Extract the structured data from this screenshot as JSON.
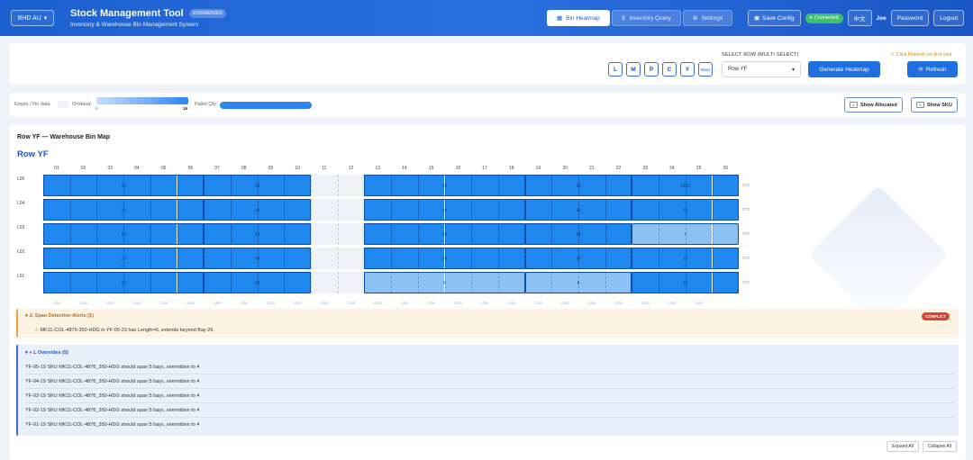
{
  "header": {
    "region": "BHD AU",
    "title": "Stock Management Tool",
    "version": "20260820002",
    "subtitle": "Inventory & Warehouse Bin Management System",
    "nav": [
      {
        "label": "Bin Heatmap",
        "icon": "grid-icon",
        "active": true
      },
      {
        "label": "Inventory Query",
        "icon": "search-icon",
        "active": false
      },
      {
        "label": "Settings",
        "icon": "gear-icon",
        "active": false
      }
    ],
    "save_config": "Save Config",
    "status": "Connected",
    "language": "中文",
    "user": "Joe",
    "password": "Password",
    "logout": "Logout"
  },
  "toolbar": {
    "row_buttons": [
      "L",
      "M",
      "P",
      "C",
      "Y",
      "More"
    ],
    "select_label": "SELECT ROW (MULTI SELECT)",
    "select_value": "Row YF",
    "generate": "Generate Heatmap",
    "refresh_hint": "Click Refresh on first visit",
    "refresh": "Refresh"
  },
  "legend": {
    "empty": "Empty / No data",
    "onhand": "OnHand:",
    "onhand_min": "0",
    "onhand_max": "16",
    "pallet": "Pallet Qty:",
    "show_allocated": "Show Allocated",
    "show_sku": "Show SKU"
  },
  "map": {
    "title": "Row YF — Warehouse Bin Map",
    "row_label": "Row YF",
    "columns": [
      "01",
      "02",
      "03",
      "04",
      "05",
      "06",
      "07",
      "08",
      "09",
      "10",
      "11",
      "12",
      "13",
      "14",
      "15",
      "16",
      "17",
      "18",
      "19",
      "20",
      "21",
      "22",
      "23",
      "24",
      "25",
      "26"
    ],
    "levels": [
      "L05",
      "L04",
      "L03",
      "L02",
      "L01"
    ],
    "row_codes": [
      "073",
      "073",
      "073",
      "073",
      "073"
    ],
    "groups": [
      {
        "level": 0,
        "start": 1,
        "end": 6,
        "tag": "10"
      },
      {
        "level": 0,
        "start": 7,
        "end": 11,
        "tag": "10"
      },
      {
        "level": 0,
        "start": 13,
        "end": 18,
        "tag": "10"
      },
      {
        "level": 0,
        "start": 19,
        "end": 22,
        "tag": "10"
      },
      {
        "level": 0,
        "start": 23,
        "end": 26,
        "tag": "10/11"
      },
      {
        "level": 1,
        "start": 1,
        "end": 6,
        "tag": "10"
      },
      {
        "level": 1,
        "start": 7,
        "end": 11,
        "tag": "10"
      },
      {
        "level": 1,
        "start": 13,
        "end": 18,
        "tag": "10"
      },
      {
        "level": 1,
        "start": 19,
        "end": 22,
        "tag": "10"
      },
      {
        "level": 1,
        "start": 23,
        "end": 26,
        "tag": "10"
      },
      {
        "level": 2,
        "start": 1,
        "end": 6,
        "tag": "10"
      },
      {
        "level": 2,
        "start": 7,
        "end": 11,
        "tag": "10"
      },
      {
        "level": 2,
        "start": 13,
        "end": 18,
        "tag": "10"
      },
      {
        "level": 2,
        "start": 19,
        "end": 22,
        "tag": "10"
      },
      {
        "level": 2,
        "start": 23,
        "end": 26,
        "tag": "7",
        "light": true
      },
      {
        "level": 3,
        "start": 1,
        "end": 6,
        "tag": "10"
      },
      {
        "level": 3,
        "start": 7,
        "end": 11,
        "tag": "10"
      },
      {
        "level": 3,
        "start": 13,
        "end": 18,
        "tag": "10"
      },
      {
        "level": 3,
        "start": 19,
        "end": 22,
        "tag": "10"
      },
      {
        "level": 3,
        "start": 23,
        "end": 26,
        "tag": "10"
      },
      {
        "level": 4,
        "start": 1,
        "end": 6,
        "tag": "10"
      },
      {
        "level": 4,
        "start": 7,
        "end": 11,
        "tag": "10"
      },
      {
        "level": 4,
        "start": 13,
        "end": 18,
        "tag": "8",
        "light": true
      },
      {
        "level": 4,
        "start": 19,
        "end": 22,
        "tag": "8",
        "light": true
      },
      {
        "level": 4,
        "start": 23,
        "end": 26,
        "tag": "10"
      }
    ],
    "foot_tick": "1200"
  },
  "alerts": {
    "title": "⚠ Span Detection Alerts (1)",
    "badge": "CONFLICT",
    "message": "MK11-COL-4876-350-HDG in YF-05-23 has Length=6, extends beyond Bay 26."
  },
  "overrides": {
    "title": "L Overrides (5)",
    "items": [
      "YF-05-19 SKU MK11-COL-4876_350-HDG should span 5 bays, overridden to 4",
      "YF-04-19 SKU MK11-COL-4876_350-HDG should span 5 bays, overridden to 4",
      "YF-03-19 SKU MK11-COL-4876_350-HDG should span 5 bays, overridden to 4",
      "YF-02-19 SKU MK11-COL-4876_350-HDG should span 5 bays, overridden to 4",
      "YF-01-19 SKU MK11-COL-4876_350-HDG should span 5 bays, overridden to 4"
    ]
  },
  "footer": {
    "expand_all": "Expand All",
    "collapse_all": "Collapse All"
  }
}
